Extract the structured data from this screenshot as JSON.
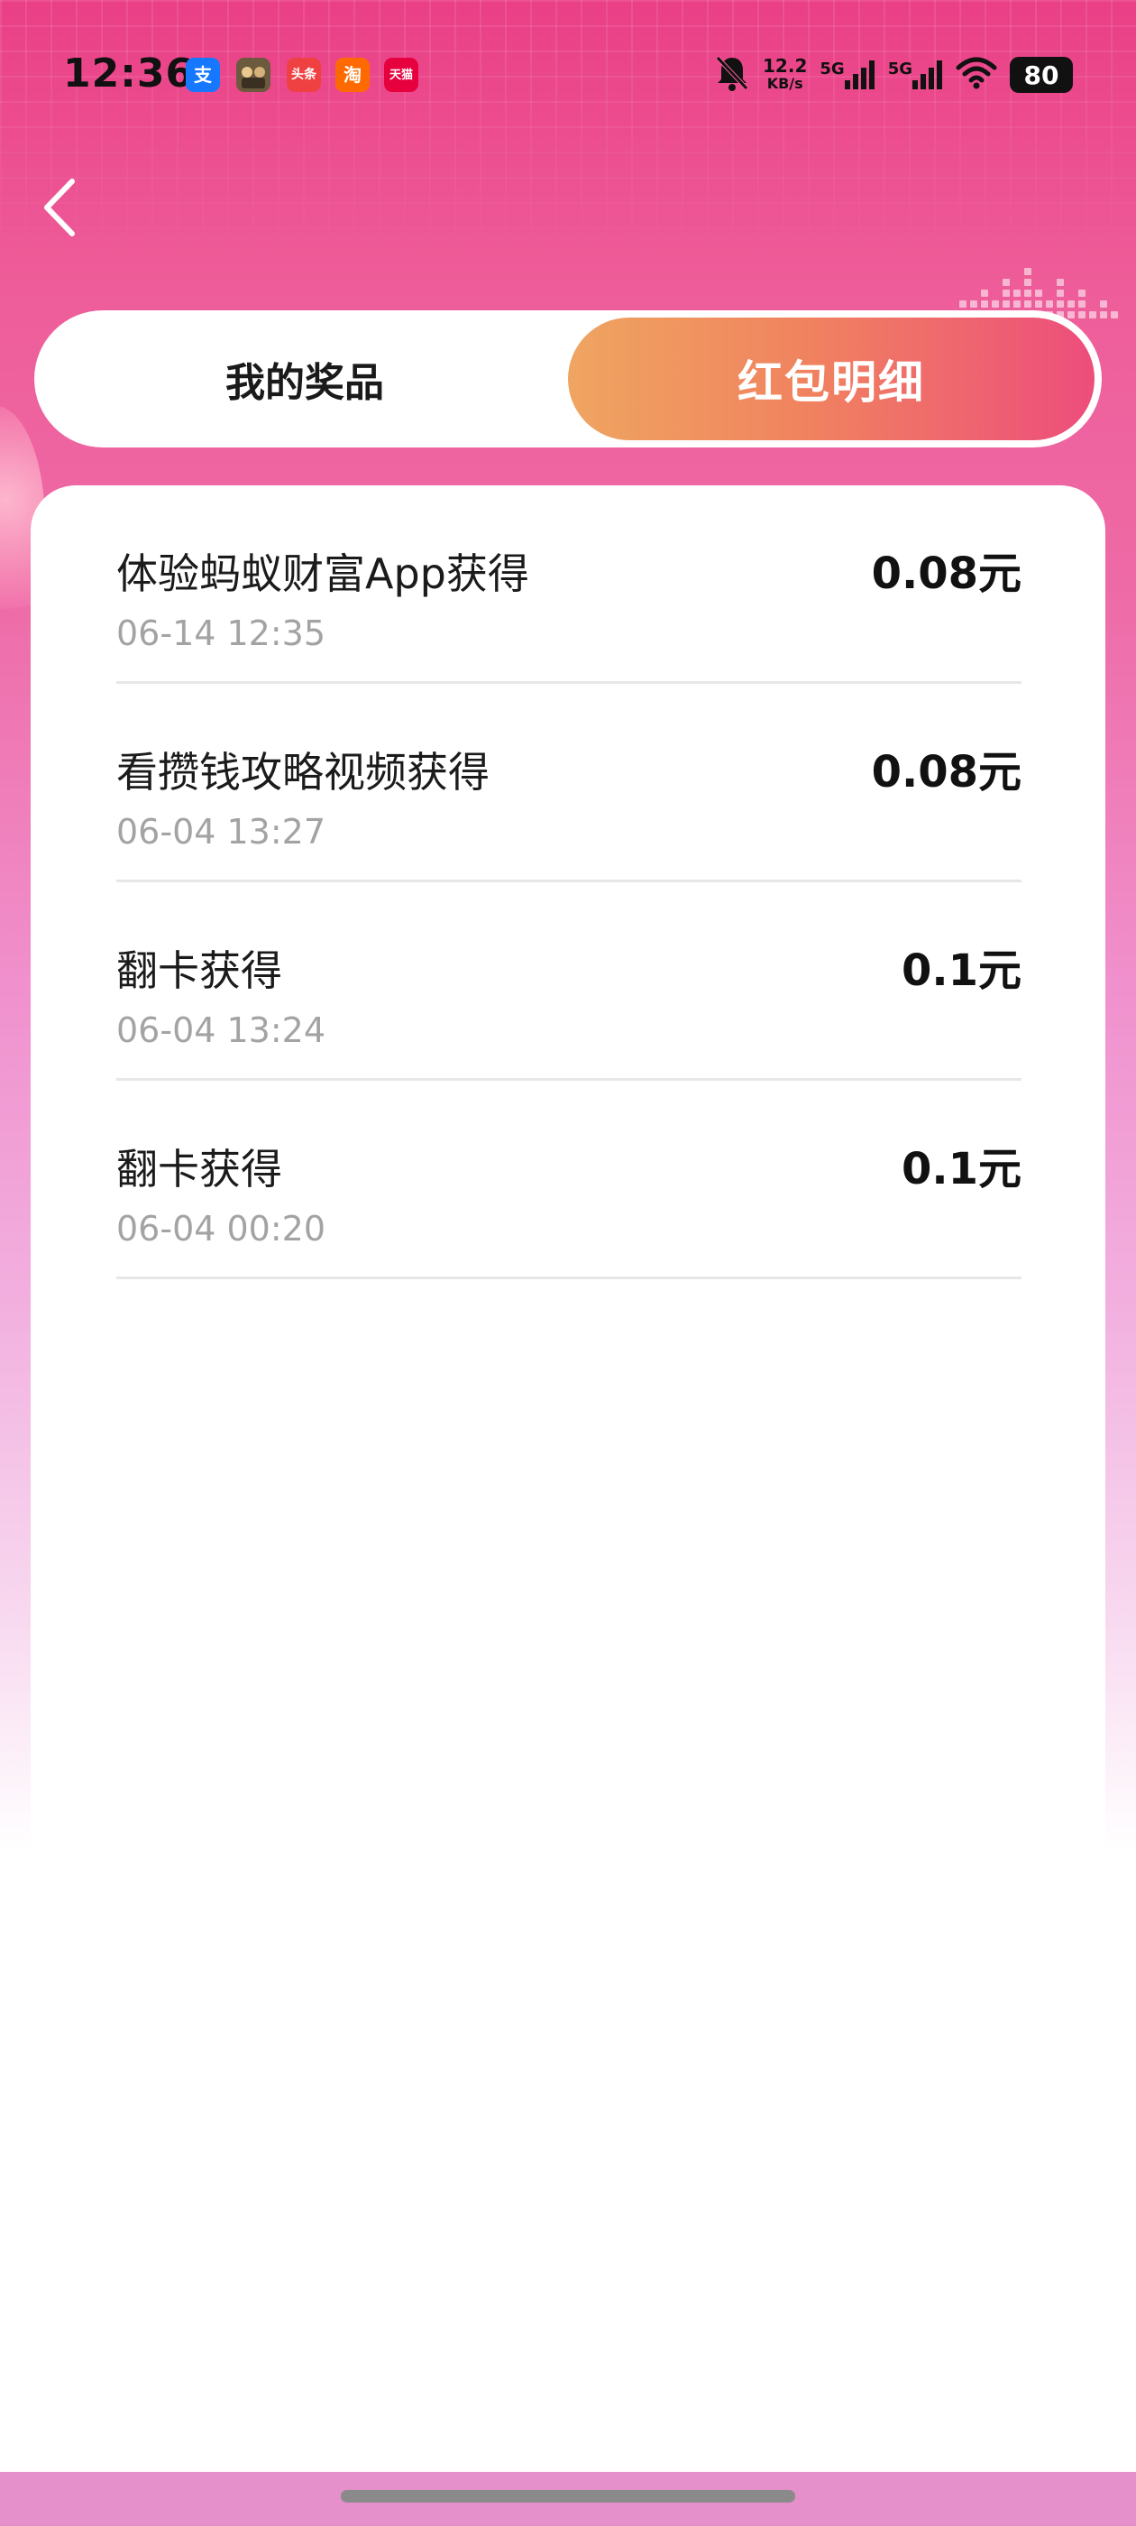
{
  "status_bar": {
    "time": "12:36",
    "app_icons": [
      {
        "name": "alipay-icon",
        "glyph": "支",
        "color": "#1677ff"
      },
      {
        "name": "game-app-icon",
        "glyph": "",
        "color": "#6b5a3e"
      },
      {
        "name": "toutiao-icon",
        "glyph": "头条",
        "color": "#f04142"
      },
      {
        "name": "taobao-icon",
        "glyph": "淘",
        "color": "#ff6a00"
      },
      {
        "name": "tmall-icon",
        "glyph": "天猫",
        "color": "#e6003e"
      }
    ],
    "net_speed_value": "12.2",
    "net_speed_unit": "KB/s",
    "sim1_label": "5G",
    "sim2_label": "5G",
    "battery": "80"
  },
  "tabs": [
    {
      "label": "我的奖品",
      "active": false
    },
    {
      "label": "红包明细",
      "active": true
    }
  ],
  "records": [
    {
      "title": "体验蚂蚁财富App获得",
      "time": "06-14 12:35",
      "amount": "0.08元"
    },
    {
      "title": "看攒钱攻略视频获得",
      "time": "06-04 13:27",
      "amount": "0.08元"
    },
    {
      "title": "翻卡获得",
      "time": "06-04 13:24",
      "amount": "0.1元"
    },
    {
      "title": "翻卡获得",
      "time": "06-04 00:20",
      "amount": "0.1元"
    }
  ],
  "colors": {
    "accent_start": "#efa561",
    "accent_end": "#ed4d7c",
    "background_top": "#ea3f86"
  }
}
